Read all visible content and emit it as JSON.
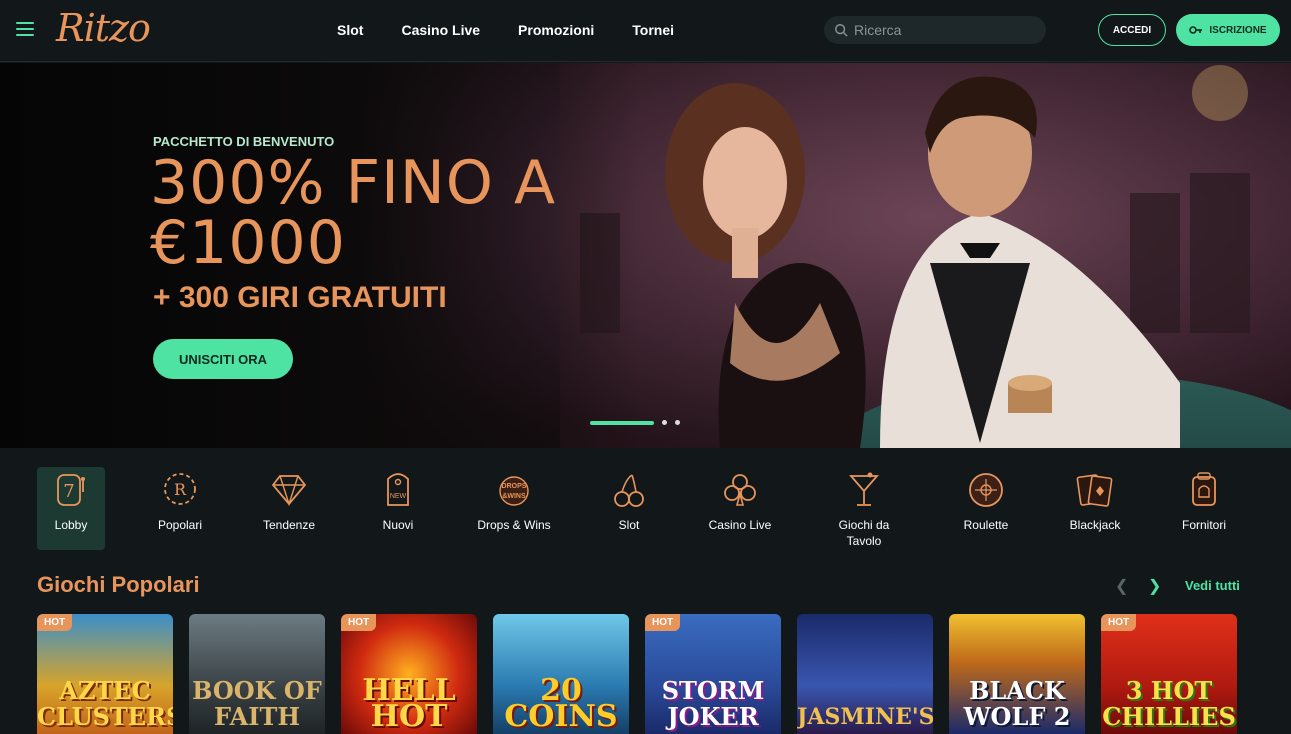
{
  "header": {
    "logo": "Ritzo",
    "nav": [
      "Slot",
      "Casino Live",
      "Promozioni",
      "Tornei"
    ],
    "search_placeholder": "Ricerca",
    "login_label": "ACCEDI",
    "signup_label": "ISCRIZIONE"
  },
  "hero": {
    "eyebrow": "PACCHETTO DI BENVENUTO",
    "title": "300% FINO A €1000",
    "subtitle": "+ 300 GIRI GRATUITI",
    "cta": "UNISCITI ORA",
    "slides": 3,
    "active_slide": 1
  },
  "categories": [
    {
      "label": "Lobby",
      "icon": "slot-seven-icon",
      "active": true
    },
    {
      "label": "Popolari",
      "icon": "laurel-badge-icon"
    },
    {
      "label": "Tendenze",
      "icon": "diamond-icon"
    },
    {
      "label": "Nuovi",
      "icon": "new-tag-icon"
    },
    {
      "label": "Drops & Wins",
      "icon": "drops-wins-icon"
    },
    {
      "label": "Slot",
      "icon": "cherries-icon"
    },
    {
      "label": "Casino Live",
      "icon": "club-icon"
    },
    {
      "label": "Giochi da Tavolo",
      "icon": "cocktail-icon"
    },
    {
      "label": "Roulette",
      "icon": "roulette-icon"
    },
    {
      "label": "Blackjack",
      "icon": "cards-icon"
    },
    {
      "label": "Fornitori",
      "icon": "provider-icon"
    }
  ],
  "popular": {
    "title": "Giochi Popolari",
    "see_all": "Vedi tutti",
    "games": [
      {
        "title": "AZTEC CLUSTERS",
        "hot": true
      },
      {
        "title": "BOOK OF FAITH",
        "hot": false
      },
      {
        "title": "HELL HOT",
        "hot": true
      },
      {
        "title": "20 COINS",
        "hot": false
      },
      {
        "title": "STORM JOKER",
        "hot": true
      },
      {
        "title": "JASMINE'S",
        "hot": false
      },
      {
        "title": "BLACK WOLF 2",
        "hot": false
      },
      {
        "title": "3 HOT CHILLIES",
        "hot": true
      }
    ],
    "hot_label": "HOT"
  },
  "colors": {
    "accent": "#4fe3a3",
    "brand": "#e8955c",
    "bg": "#12181a"
  }
}
